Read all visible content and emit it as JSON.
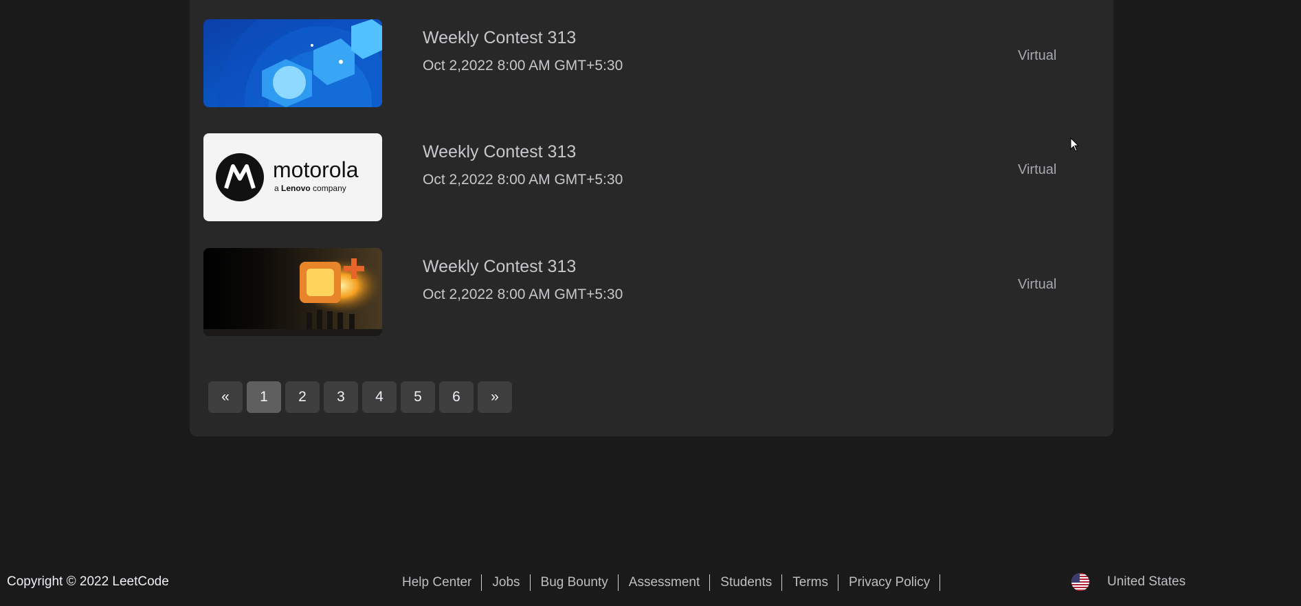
{
  "contests": [
    {
      "title": "Weekly Contest 313",
      "date": "Oct 2,2022 8:00 AM GMT+5:30",
      "action": "Virtual",
      "thumbnail_icon": "abstract-blue-shapes-icon"
    },
    {
      "title": "Weekly Contest 313",
      "date": "Oct 2,2022 8:00 AM GMT+5:30",
      "action": "Virtual",
      "thumbnail_icon": "motorola-logo"
    },
    {
      "title": "Weekly Contest 313",
      "date": "Oct 2,2022 8:00 AM GMT+5:30",
      "action": "Virtual",
      "thumbnail_icon": "game-scene-illustration"
    }
  ],
  "motorola_logo": {
    "wordmark": "motorola",
    "tagline_a": "a",
    "tagline_brand": "Lenovo",
    "tagline_rest": "company"
  },
  "pagination": {
    "prev": "«",
    "pages": [
      "1",
      "2",
      "3",
      "4",
      "5",
      "6"
    ],
    "current": "1",
    "next": "»"
  },
  "footer": {
    "copyright": "Copyright © 2022 LeetCode",
    "links": [
      "Help Center",
      "Jobs",
      "Bug Bounty",
      "Assessment",
      "Students",
      "Terms",
      "Privacy Policy"
    ],
    "region": "United States",
    "region_icon": "us-flag-icon"
  },
  "colors": {
    "page_background": "#1a1a1a",
    "panel_background": "#282828",
    "page_button": "#3e3e3e",
    "page_button_active": "#5f5f5f"
  }
}
